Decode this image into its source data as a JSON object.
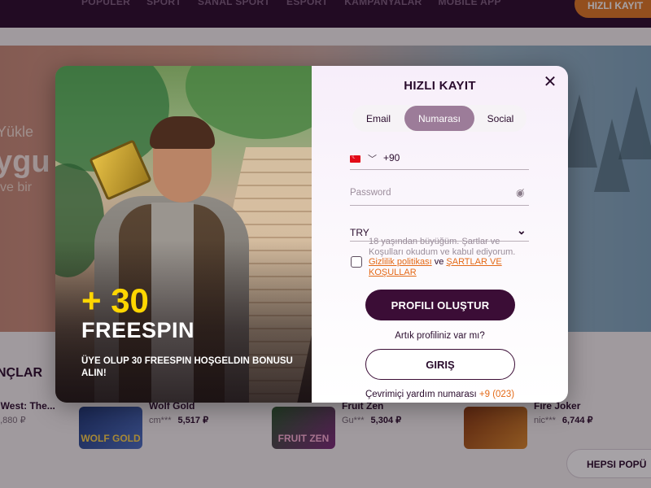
{
  "nav": {
    "links": [
      "POPÜLER",
      "SPORT",
      "SANAL SPORT",
      "ESPORT",
      "KAMPANYALAR",
      "MOBILE APP"
    ],
    "signup_button": "HIZLI KAYIT"
  },
  "hero": {
    "line1": "Yükle",
    "line2": "ygu",
    "line3": "ve bir"
  },
  "section": {
    "heading": "NÇLAR",
    "games": [
      {
        "name": "l West: The...",
        "user": "",
        "amount": "1,880 ₽",
        "thumb_text": ""
      },
      {
        "name": "Wolf Gold",
        "user": "cm***",
        "amount": "5,517 ₽",
        "thumb_text": "WOLF GOLD"
      },
      {
        "name": "Fruit Zen",
        "user": "Gu***",
        "amount": "5,304 ₽",
        "thumb_text": "FRUIT ZEN"
      },
      {
        "name": "Fire Joker",
        "user": "nic***",
        "amount": "6,744 ₽",
        "thumb_text": ""
      }
    ],
    "see_all_button": "HEPSI POPÜ"
  },
  "modal": {
    "promo": {
      "amount": "+ 30",
      "label": "FREESPIN",
      "description": "ÜYE OLUP 30 FREESPIN HOŞGELDIN BONUSU ALIN!"
    },
    "form": {
      "title": "HIZLI KAYIT",
      "tabs": [
        "Email",
        "Numarası",
        "Social"
      ],
      "active_tab": "Numarası",
      "phone_code": "+90",
      "password_placeholder": "Password",
      "currency": "TRY",
      "terms_text": "18 yaşından büyüğüm. Şartlar ve Koşulları okudum ve kabul ediyorum.",
      "privacy_link": "Gizlilik politikası",
      "and_text": "ve",
      "terms_link": "ŞARTLAR VE KOŞULLAR",
      "submit_button": "PROFILI OLUŞTUR",
      "have_account": "Artık profiliniz var mı?",
      "login_button": "GIRIŞ",
      "help_text": "Çevrimiçi yardım numarası",
      "help_number": "+9 (023)"
    }
  },
  "colors": {
    "brand_dark": "#3b0d36",
    "accent_orange": "#e46a18",
    "active_tab": "#9c7c99",
    "promo_yellow": "#ffd600"
  }
}
